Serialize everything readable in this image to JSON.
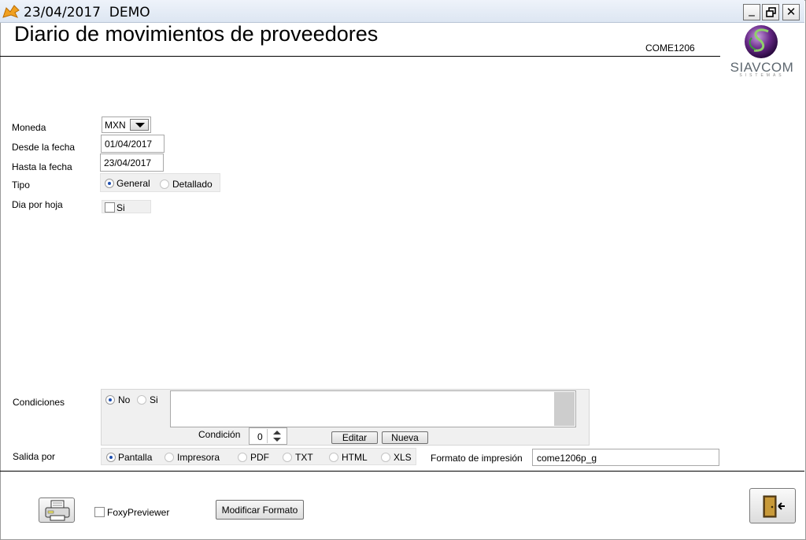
{
  "window": {
    "title": "23/04/2017  DEMO",
    "minimize_symbol": "_",
    "restore_symbol": "🗗",
    "close_symbol": "✕"
  },
  "header": {
    "title": "Diario de movimientos de proveedores",
    "form_code": "COME1206",
    "logo_text": "SIAVCOM",
    "logo_subtext": "SISTEMAS"
  },
  "form": {
    "moneda": {
      "label": "Moneda",
      "value": "MXN"
    },
    "desde": {
      "label": "Desde la fecha",
      "value": "01/04/2017"
    },
    "hasta": {
      "label": "Hasta la fecha",
      "value": "23/04/2017"
    },
    "tipo": {
      "label": "Tipo",
      "options": [
        {
          "label": "General",
          "selected": true
        },
        {
          "label": "Detallado",
          "selected": false
        }
      ]
    },
    "dia_por_hoja": {
      "label": "Dia por hoja",
      "check_label": "Si",
      "checked": false
    }
  },
  "condiciones": {
    "label": "Condiciones",
    "options": [
      {
        "label": "No",
        "selected": true
      },
      {
        "label": "Si",
        "selected": false
      }
    ],
    "condicion_label": "Condición",
    "condicion_value": "0",
    "editar_label": "Editar",
    "nueva_label": "Nueva"
  },
  "salida": {
    "label": "Salida por",
    "options": [
      {
        "label": "Pantalla",
        "selected": true
      },
      {
        "label": "Impresora",
        "selected": false
      },
      {
        "label": "PDF",
        "selected": false
      },
      {
        "label": "TXT",
        "selected": false
      },
      {
        "label": "HTML",
        "selected": false
      },
      {
        "label": "XLS",
        "selected": false
      }
    ],
    "formato_label": "Formato de impresión",
    "formato_value": "come1206p_g"
  },
  "footer": {
    "foxy_label": "FoxyPreviewer",
    "foxy_checked": false,
    "modificar_label": "Modificar Formato",
    "print_icon": "printer-icon",
    "exit_icon": "exit-door-icon"
  },
  "colors": {
    "radio_dot": "#1e4fb0",
    "panel_bg": "#f0f0f0",
    "logo_purple": "#6a2a8a",
    "logo_green": "#3a9a3a"
  }
}
